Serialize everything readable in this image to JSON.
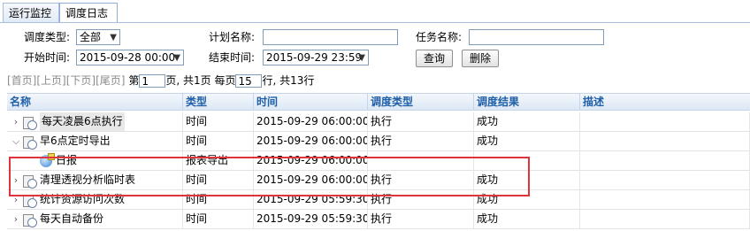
{
  "tabs": [
    {
      "label": "运行监控",
      "active": false
    },
    {
      "label": "调度日志",
      "active": true
    }
  ],
  "filters": {
    "schedule_type_label": "调度类型:",
    "schedule_type_value": "全部",
    "plan_name_label": "计划名称:",
    "plan_name_value": "",
    "task_name_label": "任务名称:",
    "task_name_value": "",
    "start_time_label": "开始时间:",
    "start_time_value": "2015-09-28 00:00",
    "end_time_label": "结束时间:",
    "end_time_value": "2015-09-29 23:59",
    "query_button": "查询",
    "delete_button": "删除"
  },
  "pager": {
    "first": "[首页]",
    "prev": "[上页]",
    "next": "[下页]",
    "last": "[尾页]",
    "page_prefix": "第",
    "page_value": "1",
    "page_suffix": "页,",
    "total_pages": "共1页",
    "per_page_prefix": "每页",
    "per_page_value": "15",
    "per_page_suffix": "行,",
    "total_rows": "共13行"
  },
  "grid": {
    "columns": [
      "名称",
      "类型",
      "时间",
      "调度类型",
      "调度结果",
      "描述"
    ],
    "rows": [
      {
        "name": "每天凌晨6点执行",
        "type": "时间",
        "time": "2015-09-29 06:00:00",
        "sched_type": "执行",
        "result": "成功",
        "desc": "",
        "expanded": false,
        "child": false,
        "selected": true
      },
      {
        "name": "早6点定时导出",
        "type": "时间",
        "time": "2015-09-29 06:00:00",
        "sched_type": "执行",
        "result": "成功",
        "desc": "",
        "expanded": true,
        "child": false,
        "selected": false
      },
      {
        "name": "日报",
        "type": "报表导出",
        "time": "2015-09-29 06:00:00",
        "sched_type": "",
        "result": "",
        "desc": "",
        "expanded": false,
        "child": true,
        "selected": false
      },
      {
        "name": "清理透视分析临时表",
        "type": "时间",
        "time": "2015-09-29 06:00:00",
        "sched_type": "执行",
        "result": "成功",
        "desc": "",
        "expanded": false,
        "child": false,
        "selected": false
      },
      {
        "name": "统计资源访问次数",
        "type": "时间",
        "time": "2015-09-29 05:59:30",
        "sched_type": "执行",
        "result": "成功",
        "desc": "",
        "expanded": false,
        "child": false,
        "selected": false
      },
      {
        "name": "每天自动备份",
        "type": "时间",
        "time": "2015-09-29 05:59:30",
        "sched_type": "执行",
        "result": "成功",
        "desc": "",
        "expanded": false,
        "child": false,
        "selected": false
      }
    ]
  },
  "colors": {
    "header_text": "#1f5fa7",
    "highlight_border": "#e0343d"
  }
}
